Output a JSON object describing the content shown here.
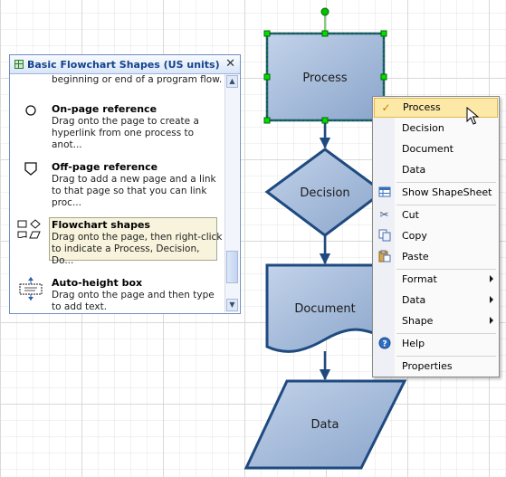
{
  "flowchart": {
    "process_label": "Process",
    "decision_label": "Decision",
    "document_label": "Document",
    "data_label": "Data"
  },
  "stencil": {
    "title": "Basic Flowchart Shapes (US units)",
    "close_glyph": "✕",
    "scroll_up": "▲",
    "scroll_down": "▼",
    "items": [
      {
        "name": "",
        "desc": "beginning or end of a program flow.",
        "icon": "terminator-icon"
      },
      {
        "name": "On-page reference",
        "desc": "Drag onto the page to create a hyperlink from one process to anot...",
        "icon": "circle-icon"
      },
      {
        "name": "Off-page reference",
        "desc": "Drag to add a new page and a link to that page so that you can link proc...",
        "icon": "pentagon-down-icon"
      },
      {
        "name": "Flowchart shapes",
        "desc": "Drag onto the page, then right-click to indicate a Process, Decision, Do...",
        "icon": "flowchart-shapes-icon"
      },
      {
        "name": "Auto-height box",
        "desc": "Drag onto the page and then type to add text.",
        "icon": "auto-height-box-icon"
      }
    ]
  },
  "context_menu": {
    "items": [
      {
        "label": "Process",
        "icon": "checkmark",
        "checked": true,
        "submenu": false
      },
      {
        "label": "Decision",
        "submenu": false
      },
      {
        "label": "Document",
        "submenu": false
      },
      {
        "label": "Data",
        "submenu": false
      },
      {
        "label": "Show ShapeSheet",
        "icon": "shapesheet-icon",
        "submenu": false
      },
      {
        "label": "Cut",
        "icon": "scissors-icon",
        "submenu": false
      },
      {
        "label": "Copy",
        "icon": "copy-icon",
        "submenu": false
      },
      {
        "label": "Paste",
        "icon": "paste-icon",
        "submenu": false
      },
      {
        "label": "Format",
        "submenu": true
      },
      {
        "label": "Data",
        "submenu": true
      },
      {
        "label": "Shape",
        "submenu": true
      },
      {
        "label": "Help",
        "icon": "help-icon",
        "submenu": false
      },
      {
        "label": "Properties",
        "submenu": false
      }
    ]
  },
  "colors": {
    "shape_fill": "#9fb6d6",
    "shape_stroke": "#1f4a80",
    "connector": "#1f4a80",
    "handle": "#00c000",
    "menu_highlight": "#fde9a7"
  }
}
